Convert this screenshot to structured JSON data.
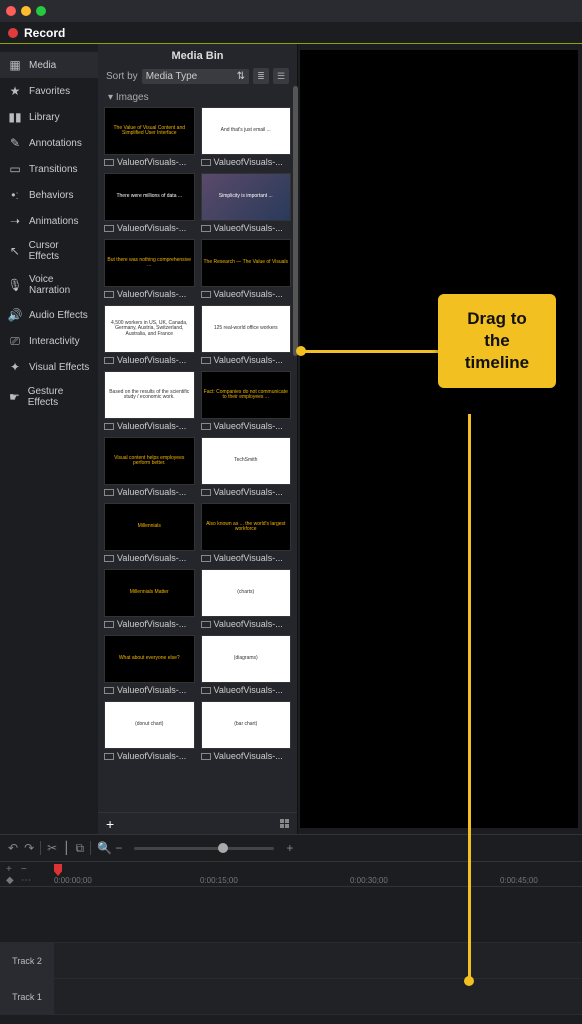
{
  "titlebar": {},
  "record": {
    "label": "Record"
  },
  "sidebar": {
    "items": [
      {
        "label": "Media",
        "icon": "media-icon",
        "active": true
      },
      {
        "label": "Favorites",
        "icon": "star-icon",
        "active": false
      },
      {
        "label": "Library",
        "icon": "library-icon",
        "active": false
      },
      {
        "label": "Annotations",
        "icon": "annotations-icon",
        "active": false
      },
      {
        "label": "Transitions",
        "icon": "transitions-icon",
        "active": false
      },
      {
        "label": "Behaviors",
        "icon": "behaviors-icon",
        "active": false
      },
      {
        "label": "Animations",
        "icon": "animations-icon",
        "active": false
      },
      {
        "label": "Cursor Effects",
        "icon": "cursor-icon",
        "active": false
      },
      {
        "label": "Voice Narration",
        "icon": "mic-icon",
        "active": false
      },
      {
        "label": "Audio Effects",
        "icon": "speaker-icon",
        "active": false
      },
      {
        "label": "Interactivity",
        "icon": "interact-icon",
        "active": false
      },
      {
        "label": "Visual Effects",
        "icon": "wand-icon",
        "active": false
      },
      {
        "label": "Gesture Effects",
        "icon": "gesture-icon",
        "active": false
      }
    ],
    "glyphs": [
      "▦",
      "★",
      "▮▮",
      "✎",
      "▭",
      "•ː",
      "➝",
      "↖",
      "🎙",
      "🔊",
      "⎚",
      "✦",
      "☛"
    ]
  },
  "mediabin": {
    "title": "Media Bin",
    "sort_label": "Sort by",
    "sort_value": "Media Type",
    "section": "Images",
    "caption": "ValueofVisuals-...",
    "thumbs": [
      {
        "style": "black gold",
        "text": "The Value of Visual Content and Simplified User Interface"
      },
      {
        "style": "white",
        "text": "And that's just email ..."
      },
      {
        "style": "black",
        "text": "There were millions of data ..."
      },
      {
        "style": "photo",
        "text": "Simplicity is important ..."
      },
      {
        "style": "black gold",
        "text": "But there was nothing comprehensive ..."
      },
      {
        "style": "black gold",
        "text": "The Research — The Value of Visuals"
      },
      {
        "style": "white",
        "text": "4,500 workers in US, UK, Canada, Germany, Austria, Switzerland, Australia, and France"
      },
      {
        "style": "white",
        "text": "125 real-world office workers"
      },
      {
        "style": "white",
        "text": "Based on the results of the scientific study / economic work."
      },
      {
        "style": "black gold",
        "text": "Fact: Companies do not communicate to their employees ..."
      },
      {
        "style": "black gold",
        "text": "Visual content helps employees perform better."
      },
      {
        "style": "white",
        "text": "TechSmith"
      },
      {
        "style": "black gold",
        "text": "Millennials"
      },
      {
        "style": "black gold",
        "text": "Also known as ... the world's largest workforce"
      },
      {
        "style": "black gold",
        "text": "Millennials Matter"
      },
      {
        "style": "white",
        "text": "(charts)"
      },
      {
        "style": "black gold",
        "text": "What about everyone else?"
      },
      {
        "style": "white",
        "text": "(diagrams)"
      },
      {
        "style": "white",
        "text": "(donut chart)"
      },
      {
        "style": "white",
        "text": "(bar chart)"
      }
    ]
  },
  "timeline": {
    "ticks": [
      "0:00:00;00",
      "0:00:15;00",
      "0:00:30;00",
      "0:00:45;00"
    ],
    "tracks": [
      "Track 2",
      "Track 1"
    ]
  },
  "callout": {
    "line1": "Drag to",
    "line2": "the",
    "line3": "timeline"
  }
}
